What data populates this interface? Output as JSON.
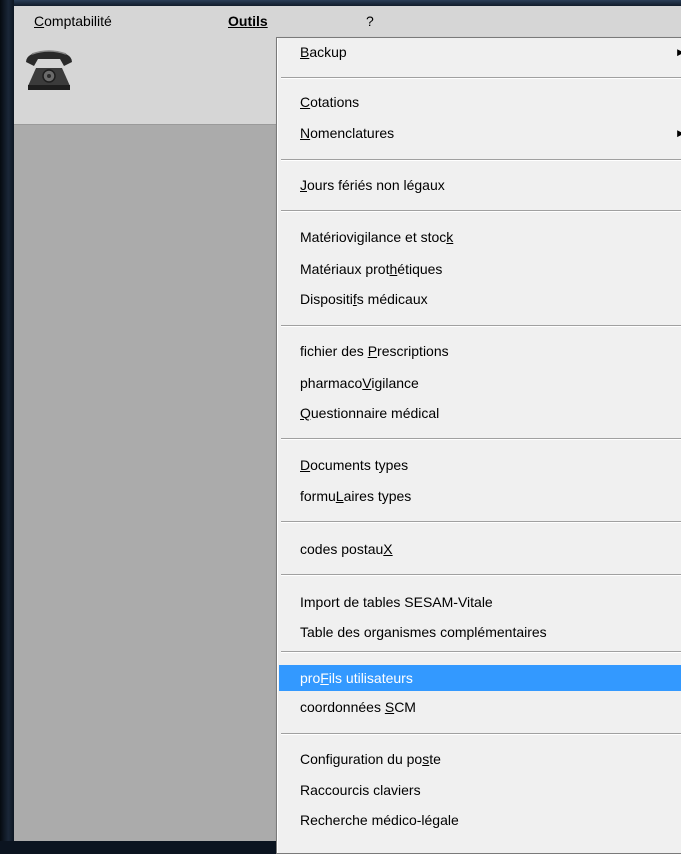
{
  "menubar": {
    "comptabilite": "Comptabilité",
    "outils": "Outils",
    "help": "?"
  },
  "toolbar": {
    "icon": "telephone-icon"
  },
  "menu": {
    "submenu_arrow": "▶",
    "items": [
      {
        "pre": "",
        "key": "B",
        "post": "ackup",
        "submenu": true
      },
      {
        "pre": "",
        "key": "C",
        "post": "otations",
        "submenu": false
      },
      {
        "pre": "",
        "key": "N",
        "post": "omenclatures",
        "submenu": true
      },
      {
        "pre": "",
        "key": "J",
        "post": "ours fériés non légaux",
        "submenu": false
      },
      {
        "pre": "Matériovigilance et stoc",
        "key": "k",
        "post": "",
        "submenu": false
      },
      {
        "pre": "Matériaux prot",
        "key": "h",
        "post": "étiques",
        "submenu": false
      },
      {
        "pre": "Dispositi",
        "key": "f",
        "post": "s médicaux",
        "submenu": false
      },
      {
        "pre": "fichier des ",
        "key": "P",
        "post": "rescriptions",
        "submenu": false
      },
      {
        "pre": "pharmaco",
        "key": "V",
        "post": "igilance",
        "submenu": false
      },
      {
        "pre": "",
        "key": "Q",
        "post": "uestionnaire médical",
        "submenu": false
      },
      {
        "pre": "",
        "key": "D",
        "post": "ocuments types",
        "submenu": false
      },
      {
        "pre": "formu",
        "key": "L",
        "post": "aires types",
        "submenu": false
      },
      {
        "pre": "codes postau",
        "key": "X",
        "post": "",
        "submenu": false
      },
      {
        "pre": "Import de tables SESAM-Vitale",
        "key": "",
        "post": "",
        "submenu": false
      },
      {
        "pre": "Table des organismes complémentaires",
        "key": "",
        "post": "",
        "submenu": false
      },
      {
        "pre": "pro",
        "key": "F",
        "post": "ils utilisateurs",
        "submenu": false,
        "highlighted": true
      },
      {
        "pre": "coordonnées ",
        "key": "S",
        "post": "CM",
        "submenu": false
      },
      {
        "pre": "Configuration du po",
        "key": "s",
        "post": "te",
        "submenu": false
      },
      {
        "pre": "Raccourcis claviers",
        "key": "",
        "post": "",
        "submenu": false
      },
      {
        "pre": "Recherche médico-légale",
        "key": "",
        "post": "",
        "submenu": false
      }
    ]
  }
}
